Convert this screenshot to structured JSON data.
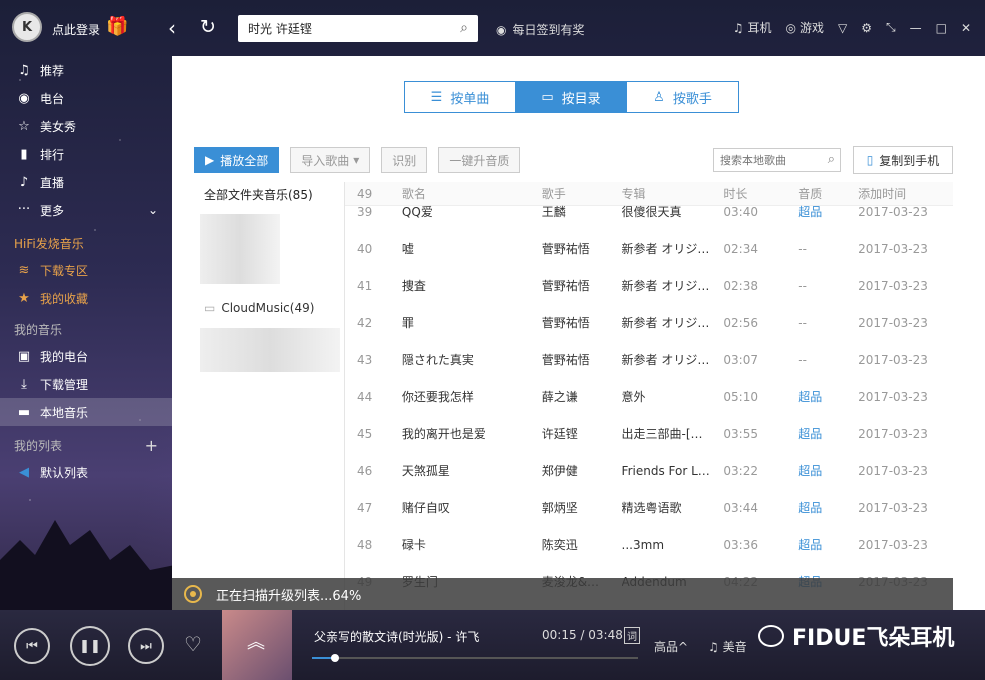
{
  "topbar": {
    "login_text": "点此登录",
    "search_value": "时光 许廷铿",
    "checkin": "每日签到有奖",
    "earphone": "耳机",
    "game": "游戏"
  },
  "sidebar": {
    "items": [
      {
        "label": "推荐",
        "icon": "music-note-icon"
      },
      {
        "label": "电台",
        "icon": "radio-icon"
      },
      {
        "label": "美女秀",
        "icon": "star-icon"
      },
      {
        "label": "排行",
        "icon": "chart-icon"
      },
      {
        "label": "直播",
        "icon": "mic-icon"
      },
      {
        "label": "更多",
        "icon": "more-icon"
      }
    ],
    "hifi_title": "HiFi发烧音乐",
    "hifi_items": [
      {
        "label": "下载专区"
      },
      {
        "label": "我的收藏"
      }
    ],
    "mymusic_title": "我的音乐",
    "mymusic_items": [
      {
        "label": "我的电台"
      },
      {
        "label": "下载管理"
      },
      {
        "label": "本地音乐"
      }
    ],
    "mylist_title": "我的列表",
    "mylist_items": [
      {
        "label": "默认列表"
      }
    ]
  },
  "tabs": [
    {
      "label": "按单曲"
    },
    {
      "label": "按目录"
    },
    {
      "label": "按歌手"
    }
  ],
  "toolbar": {
    "play_all": "播放全部",
    "import": "导入歌曲",
    "identify": "识别",
    "upgrade": "一键升音质",
    "search_placeholder": "搜索本地歌曲",
    "copy_to_phone": "复制到手机"
  },
  "folders": {
    "all": "全部文件夹音乐(85)",
    "cloud": "CloudMusic(49)"
  },
  "table": {
    "headers": {
      "num": "49",
      "name": "歌名",
      "artist": "歌手",
      "album": "专辑",
      "duration": "时长",
      "quality": "音质",
      "added": "添加时间"
    },
    "rows": [
      {
        "num": "39",
        "name": "QQ爱",
        "artist": "王麟",
        "album": "很傻很天真",
        "duration": "03:40",
        "quality": "超品",
        "added": "2017-03-23"
      },
      {
        "num": "40",
        "name": "嘘",
        "artist": "菅野祐悟",
        "album": "新参者 オリジ…",
        "duration": "02:34",
        "quality": "--",
        "added": "2017-03-23"
      },
      {
        "num": "41",
        "name": "捜査",
        "artist": "菅野祐悟",
        "album": "新参者 オリジ…",
        "duration": "02:38",
        "quality": "--",
        "added": "2017-03-23"
      },
      {
        "num": "42",
        "name": "罪",
        "artist": "菅野祐悟",
        "album": "新参者 オリジ…",
        "duration": "02:56",
        "quality": "--",
        "added": "2017-03-23"
      },
      {
        "num": "43",
        "name": "隠された真実",
        "artist": "菅野祐悟",
        "album": "新参者 オリジ…",
        "duration": "03:07",
        "quality": "--",
        "added": "2017-03-23"
      },
      {
        "num": "44",
        "name": "你还要我怎样",
        "artist": "薛之谦",
        "album": "意外",
        "duration": "05:10",
        "quality": "超品",
        "added": "2017-03-23"
      },
      {
        "num": "45",
        "name": "我的离开也是爱",
        "artist": "许廷铿",
        "album": "出走三部曲-[…",
        "duration": "03:55",
        "quality": "超品",
        "added": "2017-03-23"
      },
      {
        "num": "46",
        "name": "天煞孤星",
        "artist": "郑伊健",
        "album": "Friends For L…",
        "duration": "03:22",
        "quality": "超品",
        "added": "2017-03-23"
      },
      {
        "num": "47",
        "name": "赌仔自叹",
        "artist": "郭炳坚",
        "album": "精选粤语歌",
        "duration": "03:44",
        "quality": "超品",
        "added": "2017-03-23"
      },
      {
        "num": "48",
        "name": "碌卡",
        "artist": "陈奕迅",
        "album": "...3mm",
        "duration": "03:36",
        "quality": "超品",
        "added": "2017-03-23"
      },
      {
        "num": "49",
        "name": "罗生门",
        "artist": "麦浚龙&…",
        "album": "Addendum",
        "duration": "04:22",
        "quality": "超品",
        "added": "2017-03-23"
      }
    ]
  },
  "scan": {
    "text": "正在扫描升级列表...64%"
  },
  "player": {
    "title": "父亲写的散文诗(时光版) - 许飞",
    "time": "00:15 / 03:48",
    "lyric": "词",
    "quality": "高品^",
    "effect": "美音",
    "progress": 0.07
  },
  "watermark": {
    "text": "FIDUE飞朵耳机"
  },
  "colors": {
    "accent": "#3a8fd6",
    "hifi": "#e8a24a"
  }
}
